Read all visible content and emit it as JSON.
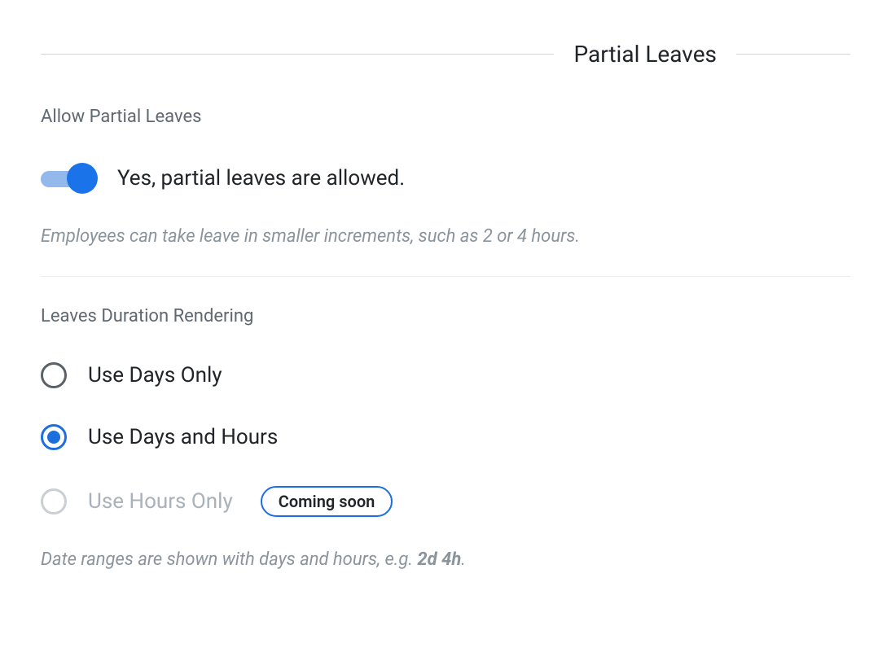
{
  "section": {
    "title": "Partial Leaves"
  },
  "allow_partial": {
    "label": "Allow Partial Leaves",
    "toggle_label": "Yes, partial leaves are allowed.",
    "help": "Employees can take leave in smaller increments, such as 2 or 4 hours.",
    "enabled": true
  },
  "duration_rendering": {
    "label": "Leaves Duration Rendering",
    "options": [
      {
        "label": "Use Days Only",
        "selected": false,
        "disabled": false
      },
      {
        "label": "Use Days and Hours",
        "selected": true,
        "disabled": false
      },
      {
        "label": "Use Hours Only",
        "selected": false,
        "disabled": true,
        "badge": "Coming soon"
      }
    ],
    "help_prefix": "Date ranges are shown with days and hours, e.g. ",
    "help_bold": "2d 4h",
    "help_suffix": "."
  }
}
